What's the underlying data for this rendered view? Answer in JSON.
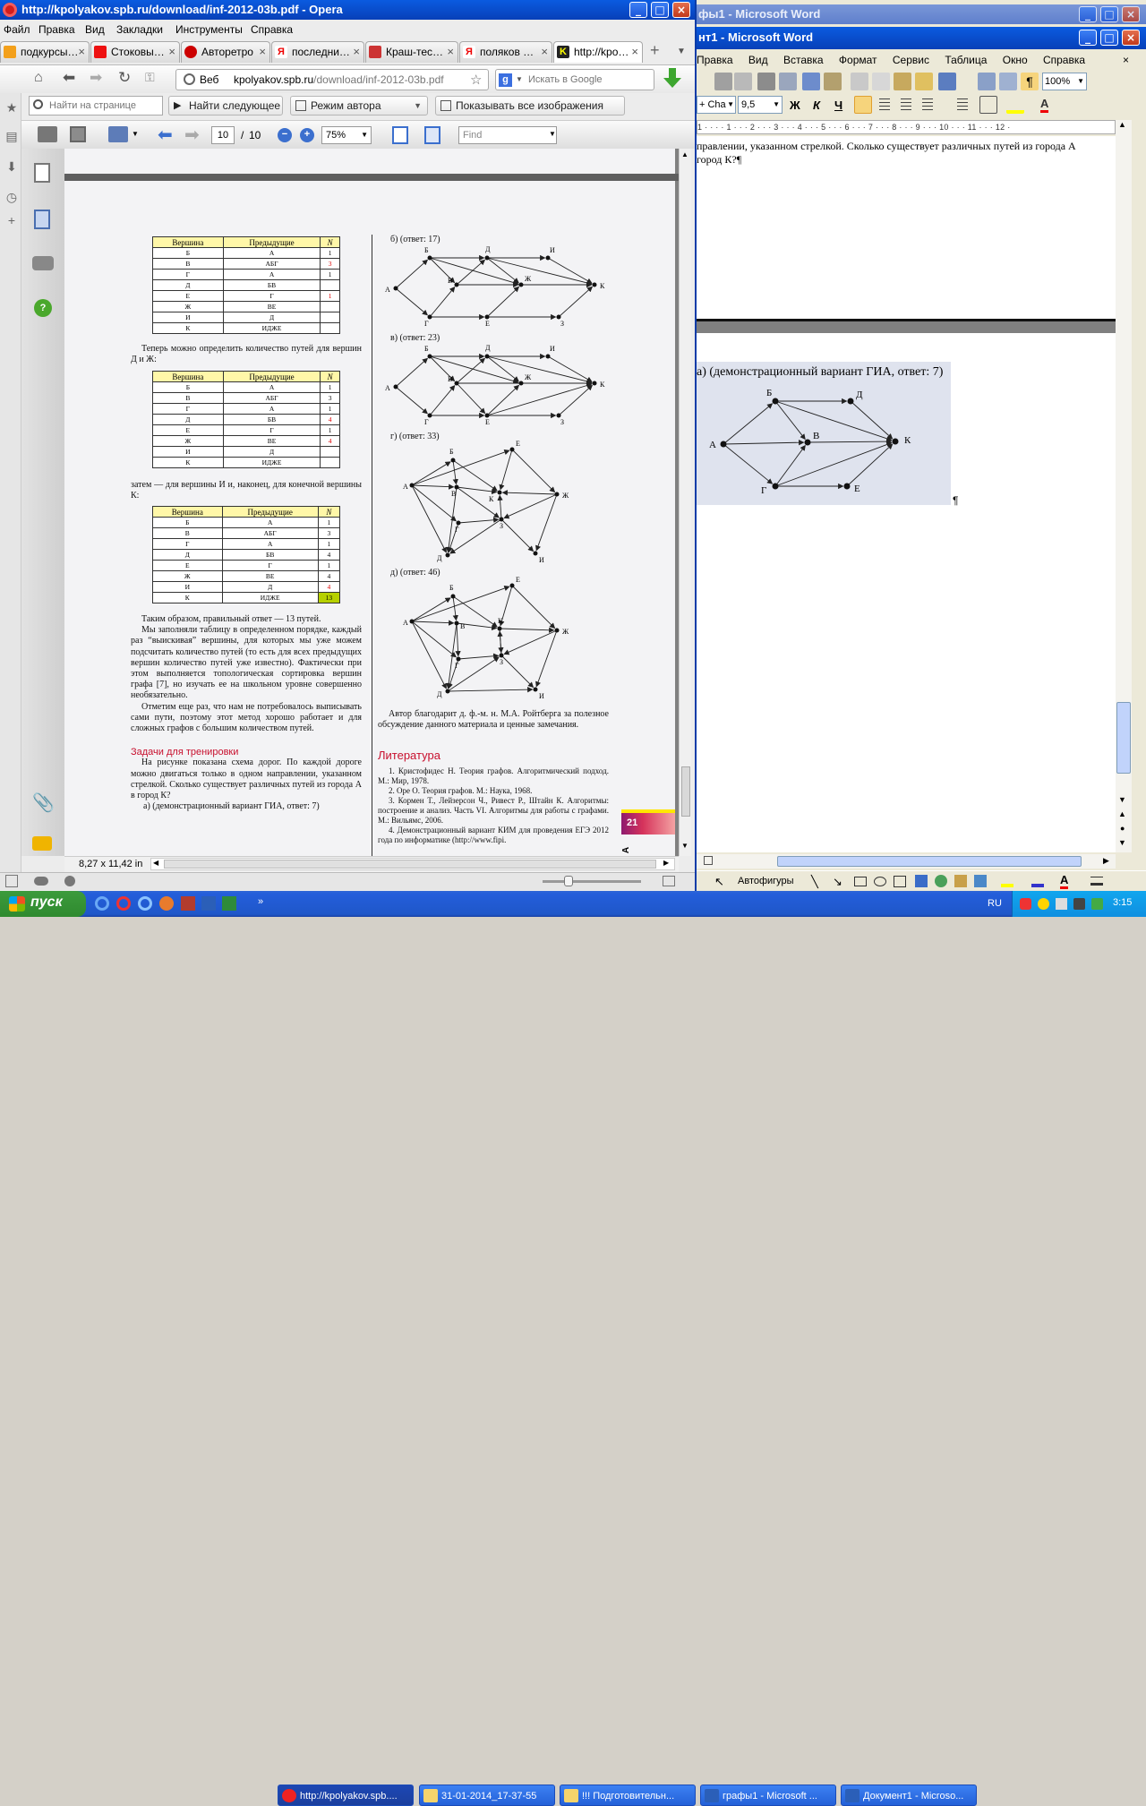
{
  "opera": {
    "title": "http://kpolyakov.spb.ru/download/inf-2012-03b.pdf - Opera",
    "menu": [
      "Файл",
      "Правка",
      "Вид",
      "Закладки",
      "Инструменты",
      "Справка"
    ],
    "tabs": [
      "подкурсы…",
      "Стоковы…",
      "Авторетро",
      "последни…",
      "Краш-тес…",
      "поляков …",
      "http://kpo…"
    ],
    "tab_plus": "+",
    "web_label": "Веб",
    "url_domain": "kpolyakov.spb.ru",
    "url_path": "/download/inf-2012-03b.pdf",
    "search_placeholder": "Искать в Google",
    "find_placeholder": "Найти на странице",
    "find_next": "Найти следующее",
    "author_mode": "Режим автора",
    "show_images": "Показывать все изображения",
    "pdf": {
      "page": "10",
      "total": "10",
      "sep": "/",
      "zoom": "75%",
      "find": "Find",
      "page_size": "8,27 x 11,42 in"
    },
    "page_number": "21"
  },
  "doc": {
    "table1": {
      "headers": [
        "Вершина",
        "Предыдущие",
        "N"
      ],
      "rows": [
        [
          "Б",
          "А",
          "1",
          ""
        ],
        [
          "В",
          "АБГ",
          "3",
          "r"
        ],
        [
          "Г",
          "А",
          "1",
          ""
        ],
        [
          "Д",
          "БВ",
          "",
          ""
        ],
        [
          "Е",
          "Г",
          "1",
          "r"
        ],
        [
          "Ж",
          "ВЕ",
          "",
          ""
        ],
        [
          "И",
          "Д",
          "",
          ""
        ],
        [
          "К",
          "ИДЖЕ",
          "",
          ""
        ]
      ]
    },
    "text1": "Теперь можно определить количество путей для вершин Д и Ж:",
    "table2": {
      "headers": [
        "Вершина",
        "Предыдущие",
        "N"
      ],
      "rows": [
        [
          "Б",
          "А",
          "1",
          ""
        ],
        [
          "В",
          "АБГ",
          "3",
          ""
        ],
        [
          "Г",
          "А",
          "1",
          ""
        ],
        [
          "Д",
          "БВ",
          "4",
          "r"
        ],
        [
          "Е",
          "Г",
          "1",
          ""
        ],
        [
          "Ж",
          "ВЕ",
          "4",
          "r"
        ],
        [
          "И",
          "Д",
          "",
          ""
        ],
        [
          "К",
          "ИДЖЕ",
          "",
          ""
        ]
      ]
    },
    "text2": "затем — для вершины И и, наконец, для конечной вершины К:",
    "table3": {
      "headers": [
        "Вершина",
        "Предыдущие",
        "N"
      ],
      "rows": [
        [
          "Б",
          "А",
          "1",
          ""
        ],
        [
          "В",
          "АБГ",
          "3",
          ""
        ],
        [
          "Г",
          "А",
          "1",
          ""
        ],
        [
          "Д",
          "БВ",
          "4",
          ""
        ],
        [
          "Е",
          "Г",
          "1",
          ""
        ],
        [
          "Ж",
          "ВЕ",
          "4",
          ""
        ],
        [
          "И",
          "Д",
          "4",
          "r"
        ],
        [
          "К",
          "ИДЖЕ",
          "13",
          "g"
        ]
      ]
    },
    "para1": "Таким образом, правильный ответ — 13 путей.",
    "para2": "Мы заполняли таблицу в определенном порядке, каждый раз “выискивая” вершины, для которых мы уже можем подсчитать количество путей (то есть для всех предыдущих вершин количество путей уже известно). Фактически при этом выполняется топологическая сортировка вершин графа [7], но изучать ее на школьном уровне совершенно необязательно.",
    "para3": "Отметим еще раз, что нам не потребовалось выписывать сами пути, поэтому этот метод хорошо работает и для сложных графов с большим количеством путей.",
    "tasks_heading": "Задачи для тренировки",
    "para4": "На рисунке показана схема дорог. По каждой дороге можно двигаться только в одном направлении, указанном стрелкой. Сколько существует различных путей из города А в город К?",
    "para5": "а) (демонстрационный вариант ГИА, ответ: 7)",
    "g_b": "б) (ответ: 17)",
    "g_v": "в) (ответ: 23)",
    "g_g": "г) (ответ: 33)",
    "g_d": "д) (ответ: 46)",
    "thanks": "Автор благодарит д. ф.-м. н. М.А. Ройтберга за полезное обсуждение данного материала и ценные замечания.",
    "lit_heading": "Литература",
    "lit": [
      "1. Кристофидес Н. Теория графов. Алгоритмический подход. М.: Мир, 1978.",
      "2. Оре О. Теория графов. М.: Наука, 1968.",
      "3. Кормен Т., Лейзерсон Ч., Ривест Р., Штайн К. Алгоритмы: построение и анализ. Часть VI. Алгоритмы для работы с графами. М.: Вильямс, 2006.",
      "4. Демонстрационный вариант КИМ для проведения ЕГЭ 2012 года по информатике (http://www.fipi."
    ],
    "side_letter": "А"
  },
  "word": {
    "title1": "фы1 - Microsoft Word",
    "title2": "нт1 - Microsoft Word",
    "menu": [
      "Правка",
      "Вид",
      "Вставка",
      "Формат",
      "Сервис",
      "Таблица",
      "Окно",
      "Справка"
    ],
    "zoom": "100%",
    "style": "+ Cha",
    "fontsize": "9,5",
    "bold": "Ж",
    "italic": "К",
    "underline": "Ч",
    "ruler": "1 · · · · 1 · · · 2 · · · 3 · · · 4 · · · 5 · · · 6 · · · 7 · · · 8 · · · 9 · · · 10 · · · 11 · · · 12 ·",
    "line1": "правлении, указанном стрелкой. Сколько существует различных путей из города А",
    "line2": "город К?¶",
    "caption": "а) (демонстрационный вариант ГИА, ответ: 7)",
    "pilcrow": "¶",
    "autoshapes": "Автофигуры"
  },
  "taskbar": {
    "start": "пуск",
    "items": [
      "http://kpolyakov.spb....",
      "31-01-2014_17-37-55",
      "!!! Подготовительн...",
      "графы1 - Microsoft ...",
      "Документ1 - Microso..."
    ],
    "lang": "RU",
    "time": "3:15"
  }
}
